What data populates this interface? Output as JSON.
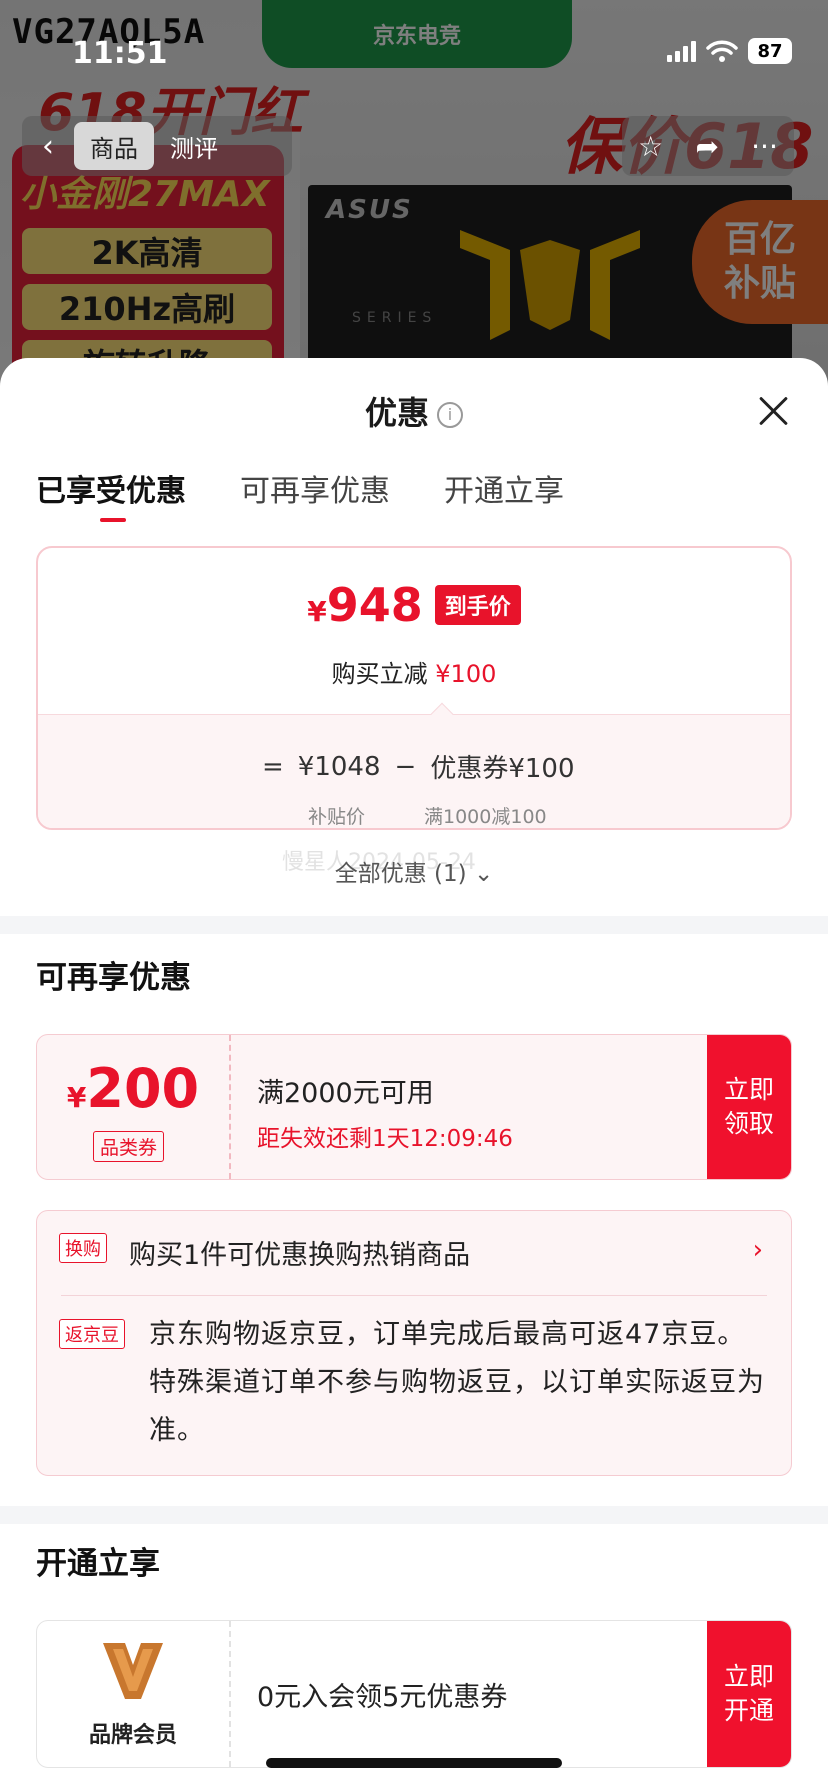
{
  "background": {
    "brand_code": "VG27AQL5A",
    "top_banner": "京东电竞",
    "promo_left": "618开门红",
    "model": "小金刚27MAX",
    "features": [
      "2K高清",
      "210Hz高刷",
      "旋转升降"
    ],
    "monitor_brand": "ASUS",
    "monitor_series": "SERIES",
    "promo_right": "保价618",
    "subsidy_badge": [
      "百亿",
      "补贴"
    ]
  },
  "status_bar": {
    "time": "11:51",
    "battery": "87"
  },
  "nav": {
    "tabs": [
      "商品",
      "测评"
    ],
    "active_tab": 0
  },
  "sheet": {
    "title": "优惠",
    "info_glyph": "i",
    "tabs": [
      "已享受优惠",
      "可再享优惠",
      "开通立享"
    ],
    "price_card": {
      "currency": "¥",
      "final_price": "948",
      "final_tag": "到手价",
      "reduce_label": "购买立减",
      "reduce_amount": "¥100",
      "equals": "=",
      "base_price": "¥1048",
      "minus": "−",
      "coupon_label": "优惠券¥100",
      "base_label": "补贴价",
      "coupon_condition": "满1000减100"
    },
    "all_discounts": "全部优惠 (1)",
    "watermark": "慢星人2024-05-24"
  },
  "more_offers": {
    "title": "可再享优惠",
    "coupon": {
      "currency": "¥",
      "amount": "200",
      "type": "品类券",
      "condition": "满2000元可用",
      "expire": "距失效还剩1天12:09:46",
      "button": [
        "立即",
        "领取"
      ]
    },
    "exchange": {
      "badge": "换购",
      "text": "购买1件可优惠换购热销商品"
    },
    "beans": {
      "badge": "返京豆",
      "text": "京东购物返京豆，订单完成后最高可返47京豆。特殊渠道订单不参与购物返豆，以订单实际返豆为准。"
    }
  },
  "membership": {
    "title": "开通立享",
    "card": {
      "name": "品牌会员",
      "text": "0元入会领5元优惠券",
      "button": [
        "立即",
        "开通"
      ]
    }
  },
  "colors": {
    "accent": "#e8132b",
    "button": "#f0112d",
    "card_bg": "#fdf4f5",
    "divider": "#f4f5f7"
  }
}
